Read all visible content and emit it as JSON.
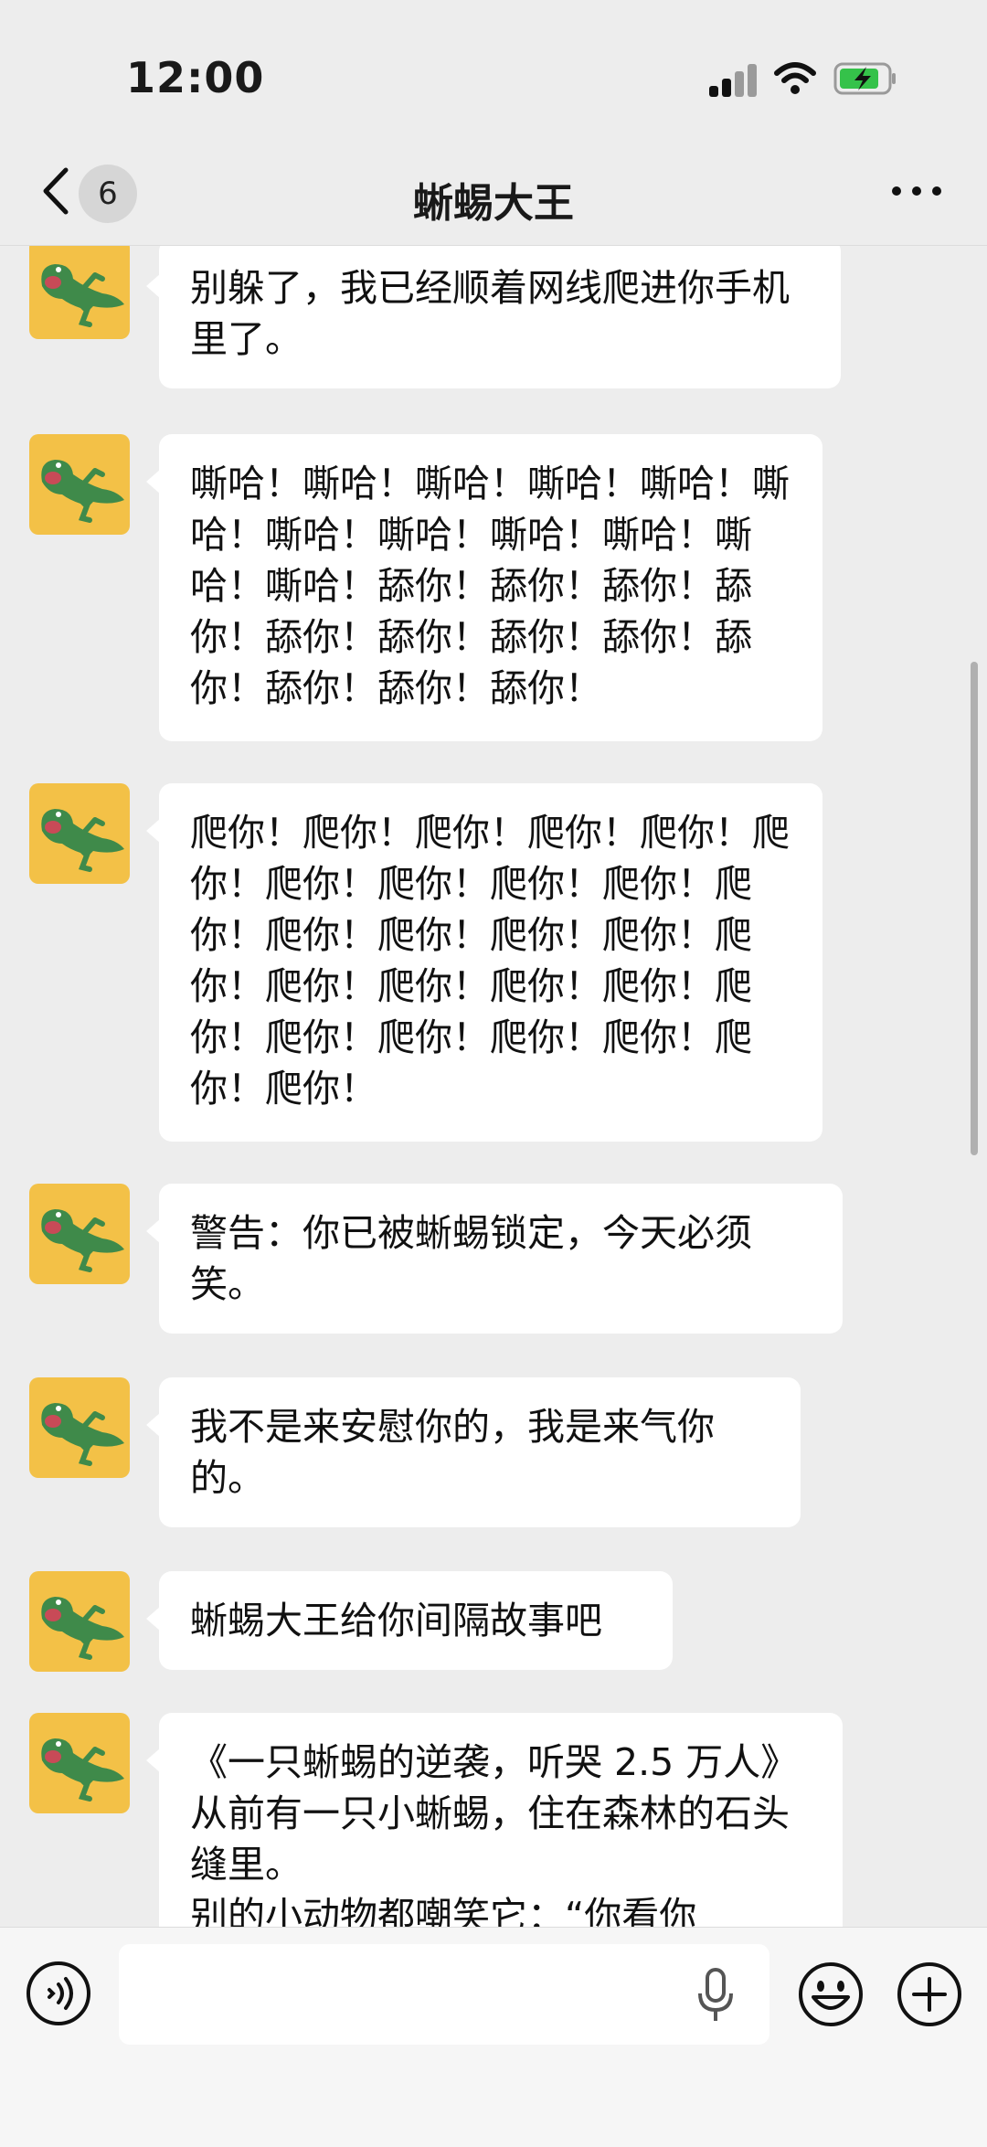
{
  "status_bar": {
    "time": "12:00"
  },
  "nav": {
    "unread_count": "6",
    "title": "蜥蜴大王"
  },
  "messages": [
    {
      "text": "别躲了，我已经顺着网线爬进你手机里了。"
    },
    {
      "text": "嘶哈！嘶哈！嘶哈！嘶哈！嘶哈！嘶哈！嘶哈！嘶哈！嘶哈！嘶哈！嘶哈！嘶哈！舔你！舔你！舔你！舔你！舔你！舔你！舔你！舔你！舔你！舔你！舔你！舔你！"
    },
    {
      "text": "爬你！爬你！爬你！爬你！爬你！爬你！爬你！爬你！爬你！爬你！爬你！爬你！爬你！爬你！爬你！爬你！爬你！爬你！爬你！爬你！爬你！爬你！爬你！爬你！爬你！爬你！爬你！"
    },
    {
      "text": "警告：你已被蜥蜴锁定，今天必须笑。"
    },
    {
      "text": "我不是来安慰你的，我是来气你的。"
    },
    {
      "text": "蜥蜴大王给你间隔故事吧"
    },
    {
      "text": "《一只蜥蜴的逆袭，听哭 2.5 万人》\n从前有一只小蜥蜴，住在森林的石头缝里。\n别的小动物都嘲笑它：“你看你"
    }
  ],
  "input": {
    "placeholder": ""
  },
  "colors": {
    "avatar_bg": "#f3c147",
    "lizard_green": "#3f8a4a",
    "chat_bg": "#ededed",
    "bubble_bg": "#ffffff"
  }
}
